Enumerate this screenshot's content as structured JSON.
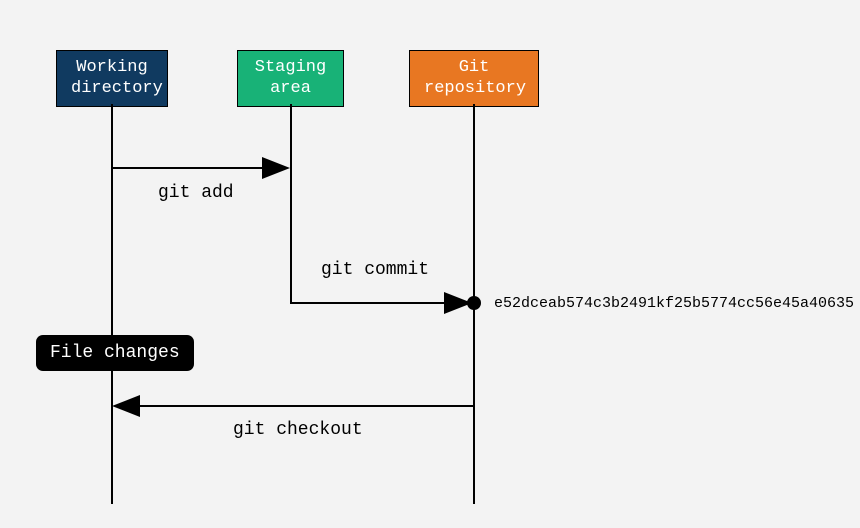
{
  "participants": {
    "working_directory": {
      "line1": "Working",
      "line2": "directory"
    },
    "staging_area": {
      "line1": "Staging",
      "line2": "area"
    },
    "git_repository": {
      "line1": "Git",
      "line2": "repository"
    }
  },
  "messages": {
    "add": "git add",
    "commit": "git commit",
    "checkout": "git checkout"
  },
  "note": "File changes",
  "commit_hash": "e52dceab574c3b2491kf25b5774cc56e45a40635",
  "layout": {
    "colors": {
      "working_directory": "#103a60",
      "staging_area": "#18b277",
      "git_repository": "#e87722"
    }
  }
}
